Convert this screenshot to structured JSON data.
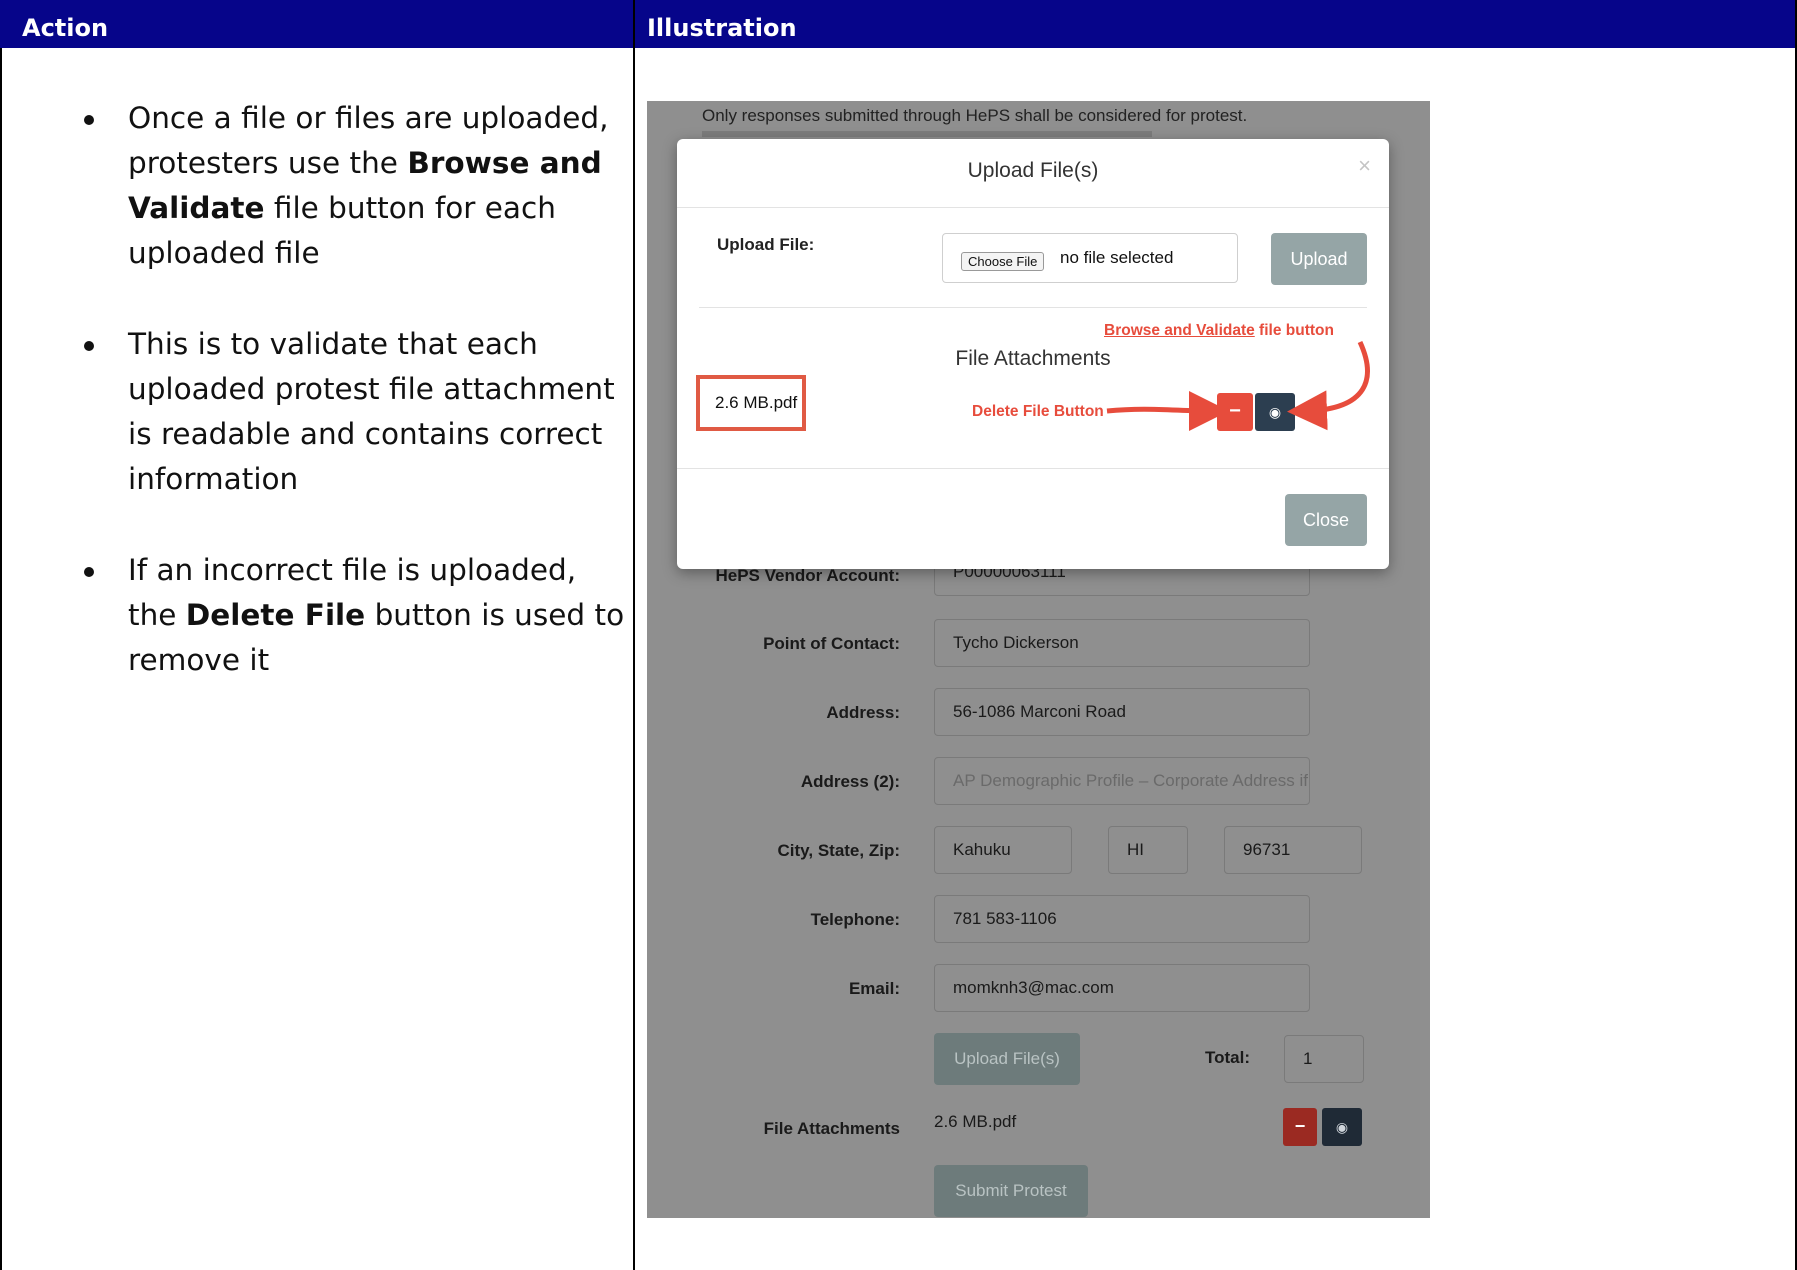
{
  "header": {
    "action": "Action",
    "illustration": "Illustration"
  },
  "bullets": [
    {
      "parts": [
        {
          "text": "Once a file or files are uploaded, protesters use the ",
          "bold": false
        },
        {
          "text": "Browse and Validate",
          "bold": true
        },
        {
          "text": " file button for each uploaded file",
          "bold": false
        }
      ]
    },
    {
      "parts": [
        {
          "text": "This is to validate that each uploaded protest file attachment is readable and contains correct information",
          "bold": false
        }
      ]
    },
    {
      "parts": [
        {
          "text": "If an incorrect file is uploaded, the ",
          "bold": false
        },
        {
          "text": "Delete File",
          "bold": true
        },
        {
          "text": " button is used to remove it",
          "bold": false
        }
      ]
    }
  ],
  "screenshot": {
    "top_note": "Only responses submitted through HePS shall be considered for protest.",
    "modal": {
      "title": "Upload File(s)",
      "close_glyph": "×",
      "upload_label": "Upload File:",
      "choose_file": "Choose File",
      "no_file": "no file selected",
      "upload_button": "Upload",
      "attachments_heading": "File Attachments",
      "file_name": "2.6 MB.pdf",
      "annotation_browse_link": "Browse and Validate",
      "annotation_browse_rest": " file button",
      "annotation_delete": "Delete File Button",
      "delete_glyph": "−",
      "view_icon": "eye-icon",
      "close_button": "Close"
    },
    "form": {
      "vendor_label": "HePS Vendor Account:",
      "vendor_value": "P00000063111",
      "contact_label": "Point of Contact:",
      "contact_value": "Tycho Dickerson",
      "address_label": "Address:",
      "address_value": "56-1086 Marconi Road",
      "address2_label": "Address (2):",
      "address2_placeholder": "AP Demographic Profile – Corporate Address if ad",
      "csz_label": "City, State, Zip:",
      "city": "Kahuku",
      "state": "HI",
      "zip": "96731",
      "phone_label": "Telephone:",
      "phone_value": "781 583-1106",
      "email_label": "Email:",
      "email_value": "momknh3@mac.com",
      "upload_files_button": "Upload File(s)",
      "total_label": "Total:",
      "total_value": "1",
      "attachments_label": "File Attachments",
      "attachment_file": "2.6 MB.pdf",
      "submit_button": "Submit Protest"
    }
  },
  "colors": {
    "header_bg": "#06058a",
    "danger": "#e74c3c",
    "dark": "#2c3e50",
    "muted_button": "#95a5a6"
  }
}
